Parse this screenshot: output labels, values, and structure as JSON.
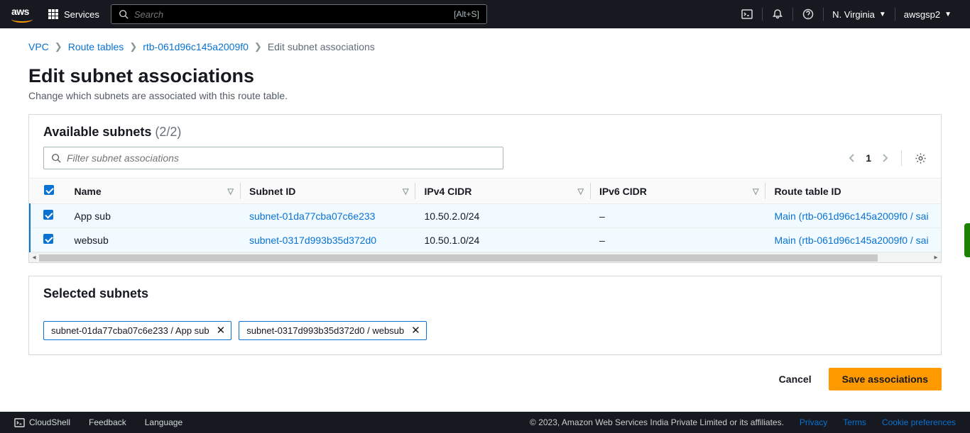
{
  "header": {
    "services_label": "Services",
    "search_placeholder": "Search",
    "search_shortcut": "[Alt+S]",
    "region": "N. Virginia",
    "user": "awsgsp2"
  },
  "breadcrumbs": {
    "vpc": "VPC",
    "route_tables": "Route tables",
    "rt_id": "rtb-061d96c145a2009f0",
    "current": "Edit subnet associations"
  },
  "page": {
    "title": "Edit subnet associations",
    "description": "Change which subnets are associated with this route table."
  },
  "available_panel": {
    "title": "Available subnets",
    "count_display": "(2/2)",
    "filter_placeholder": "Filter subnet associations",
    "page_num": "1",
    "columns": {
      "name": "Name",
      "subnet_id": "Subnet ID",
      "ipv4": "IPv4 CIDR",
      "ipv6": "IPv6 CIDR",
      "rt": "Route table ID"
    },
    "rows": [
      {
        "name": "App sub",
        "subnet_id": "subnet-01da77cba07c6e233",
        "ipv4": "10.50.2.0/24",
        "ipv6": "–",
        "rt": "Main (rtb-061d96c145a2009f0 / sai"
      },
      {
        "name": "websub",
        "subnet_id": "subnet-0317d993b35d372d0",
        "ipv4": "10.50.1.0/24",
        "ipv6": "–",
        "rt": "Main (rtb-061d96c145a2009f0 / sai"
      }
    ]
  },
  "selected_panel": {
    "title": "Selected subnets",
    "chips": [
      "subnet-01da77cba07c6e233 / App sub",
      "subnet-0317d993b35d372d0 / websub"
    ]
  },
  "actions": {
    "cancel": "Cancel",
    "save": "Save associations"
  },
  "footer": {
    "cloudshell": "CloudShell",
    "feedback": "Feedback",
    "language": "Language",
    "copyright": "© 2023, Amazon Web Services India Private Limited or its affiliates.",
    "privacy": "Privacy",
    "terms": "Terms",
    "cookie": "Cookie preferences"
  }
}
